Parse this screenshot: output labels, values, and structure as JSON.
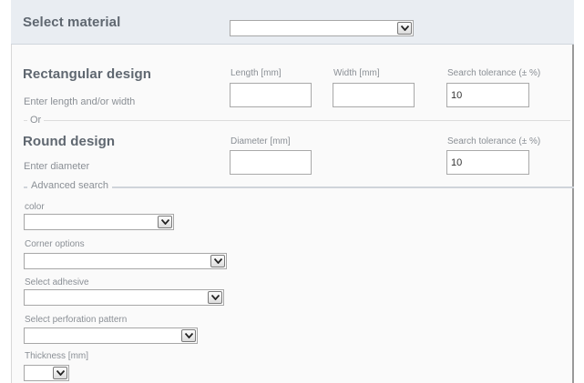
{
  "material": {
    "label": "Select material",
    "value": ""
  },
  "rectangular": {
    "title": "Rectangular design",
    "hint": "Enter length and/or width",
    "length_label": "Length [mm]",
    "length_value": "",
    "width_label": "Width [mm]",
    "width_value": "",
    "tolerance_label": "Search tolerance (± %)",
    "tolerance_value": "10"
  },
  "or_label": "Or",
  "round": {
    "title": "Round design",
    "hint": "Enter diameter",
    "diameter_label": "Diameter [mm]",
    "diameter_value": "",
    "tolerance_label": "Search tolerance (± %)",
    "tolerance_value": "10"
  },
  "advanced": {
    "legend": "Advanced search",
    "color_label": "color",
    "corner_label": "Corner options",
    "adhesive_label": "Select adhesive",
    "perforation_label": "Select perforation pattern",
    "thickness_label": "Thickness [mm]"
  },
  "colors": {
    "header_bg": "#e9edf2",
    "title_text": "#5f6770",
    "muted_text": "#8a8f95",
    "panel_bg": "#fafafa"
  }
}
